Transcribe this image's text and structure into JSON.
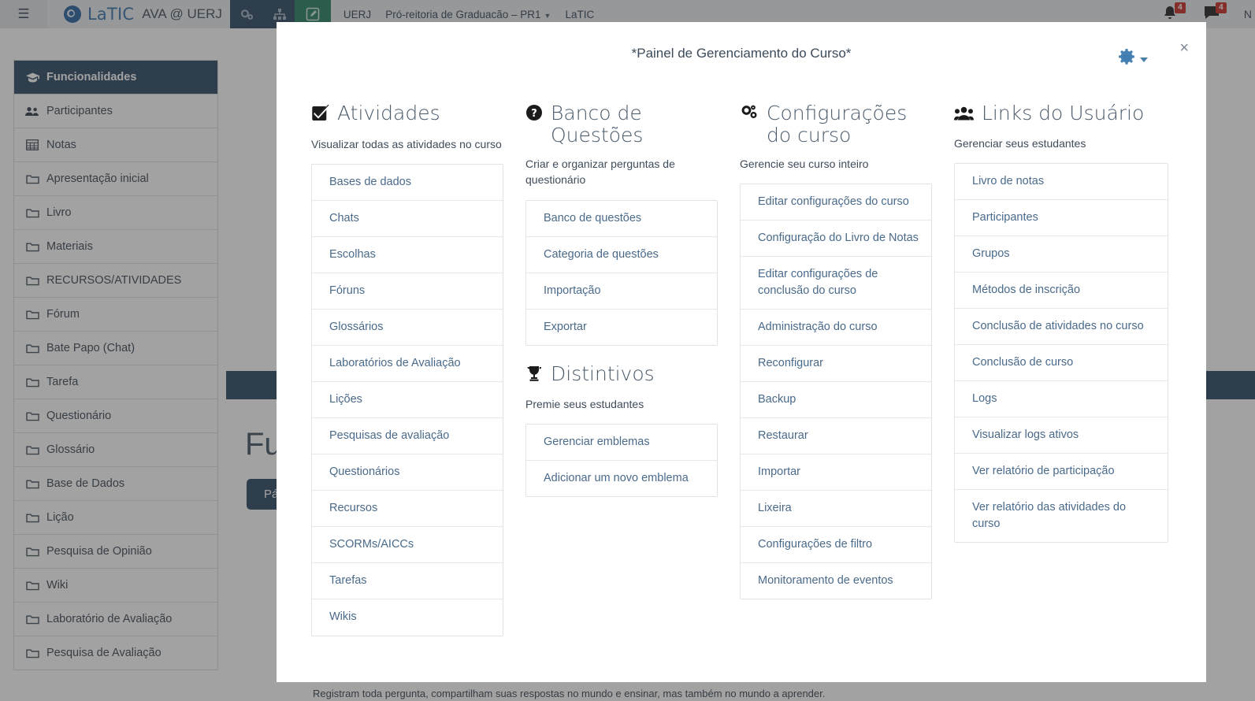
{
  "navbar": {
    "burger_icon": "hamburger-menu-icon",
    "brand": "LaTIC",
    "brand_sub": "AVA @ UERJ",
    "icons": [
      "gears-icon",
      "sitemap-icon",
      "edit-pencil-icon"
    ],
    "breadcrumbs": [
      "UERJ",
      "Pró-reitoria de Graduacão – PR1",
      "LaTIC"
    ],
    "notifications_badge": "4",
    "messages_badge": "4",
    "user_initial": "N"
  },
  "sidebar": {
    "header": "Funcionalidades",
    "header_icon": "graduation-cap-icon",
    "items": [
      {
        "label": "Participantes",
        "icon": "users-icon"
      },
      {
        "label": "Notas",
        "icon": "table-icon"
      },
      {
        "label": "Apresentação inicial",
        "icon": "folder-icon"
      },
      {
        "label": "Livro",
        "icon": "folder-icon"
      },
      {
        "label": "Materiais",
        "icon": "folder-icon"
      },
      {
        "label": "RECURSOS/ATIVIDADES",
        "icon": "folder-icon"
      },
      {
        "label": "Fórum",
        "icon": "folder-icon"
      },
      {
        "label": "Bate Papo (Chat)",
        "icon": "folder-icon"
      },
      {
        "label": "Tarefa",
        "icon": "folder-icon"
      },
      {
        "label": "Questionário",
        "icon": "folder-icon"
      },
      {
        "label": "Glossário",
        "icon": "folder-icon"
      },
      {
        "label": "Base de Dados",
        "icon": "folder-icon"
      },
      {
        "label": "Lição",
        "icon": "folder-icon"
      },
      {
        "label": "Pesquisa de Opinião",
        "icon": "folder-icon"
      },
      {
        "label": "Wiki",
        "icon": "folder-icon"
      },
      {
        "label": "Laboratório de Avaliação",
        "icon": "folder-icon"
      },
      {
        "label": "Pesquisa de Avaliação",
        "icon": "folder-icon"
      }
    ]
  },
  "background": {
    "page_heading": "Fu",
    "primary_button": "Pá",
    "footer_text": "Registram toda pergunta, compartilham suas respostas no mundo e ensinar, mas também no mundo a aprender."
  },
  "modal": {
    "title": "*Painel de Gerenciamento do Curso*",
    "gear_icon": "gear-icon",
    "gear_caret_icon": "chevron-down-icon",
    "close_label": "×",
    "sections": [
      {
        "title": "Atividades",
        "icon": "checked-box-icon",
        "description": "Visualizar todas as atividades no curso",
        "links": [
          "Bases de dados",
          "Chats",
          "Escolhas",
          "Fóruns",
          "Glossários",
          "Laboratórios de Avaliação",
          "Lições",
          "Pesquisas de avaliação",
          "Questionários",
          "Recursos",
          "SCORMs/AICCs",
          "Tarefas",
          "Wikis"
        ]
      },
      {
        "title": "Banco de Questões",
        "icon": "question-circle-icon",
        "description": "Criar e organizar perguntas de questionário",
        "links": [
          "Banco de questões",
          "Categoria de questões",
          "Importação",
          "Exportar"
        ]
      },
      {
        "title": "Distintivos",
        "icon": "trophy-icon",
        "description": "Premie seus estudantes",
        "links": [
          "Gerenciar emblemas",
          "Adicionar um novo emblema"
        ]
      },
      {
        "title": "Configurações do curso",
        "icon": "cogs-icon",
        "description": "Gerencie seu curso inteiro",
        "links": [
          "Editar configurações do curso",
          "Configuração do Livro de Notas",
          "Editar configurações de conclusão do curso",
          "Administração do curso",
          "Reconfigurar",
          "Backup",
          "Restaurar",
          "Importar",
          "Lixeira",
          "Configurações de filtro",
          "Monitoramento de eventos"
        ]
      },
      {
        "title": "Links do Usuário",
        "icon": "users-group-icon",
        "description": "Gerenciar seus estudantes",
        "links": [
          "Livro de notas",
          "Participantes",
          "Grupos",
          "Métodos de inscrição",
          "Conclusão de atividades no curso",
          "Conclusão de curso",
          "Logs",
          "Visualizar logs ativos",
          "Ver relatório de participação",
          "Ver relatório das atividades do curso"
        ]
      }
    ]
  },
  "colors": {
    "navy": "#23405c",
    "green": "#1e7a5a",
    "link_blue": "#4a6a8a",
    "badge_red": "#c7241a"
  }
}
